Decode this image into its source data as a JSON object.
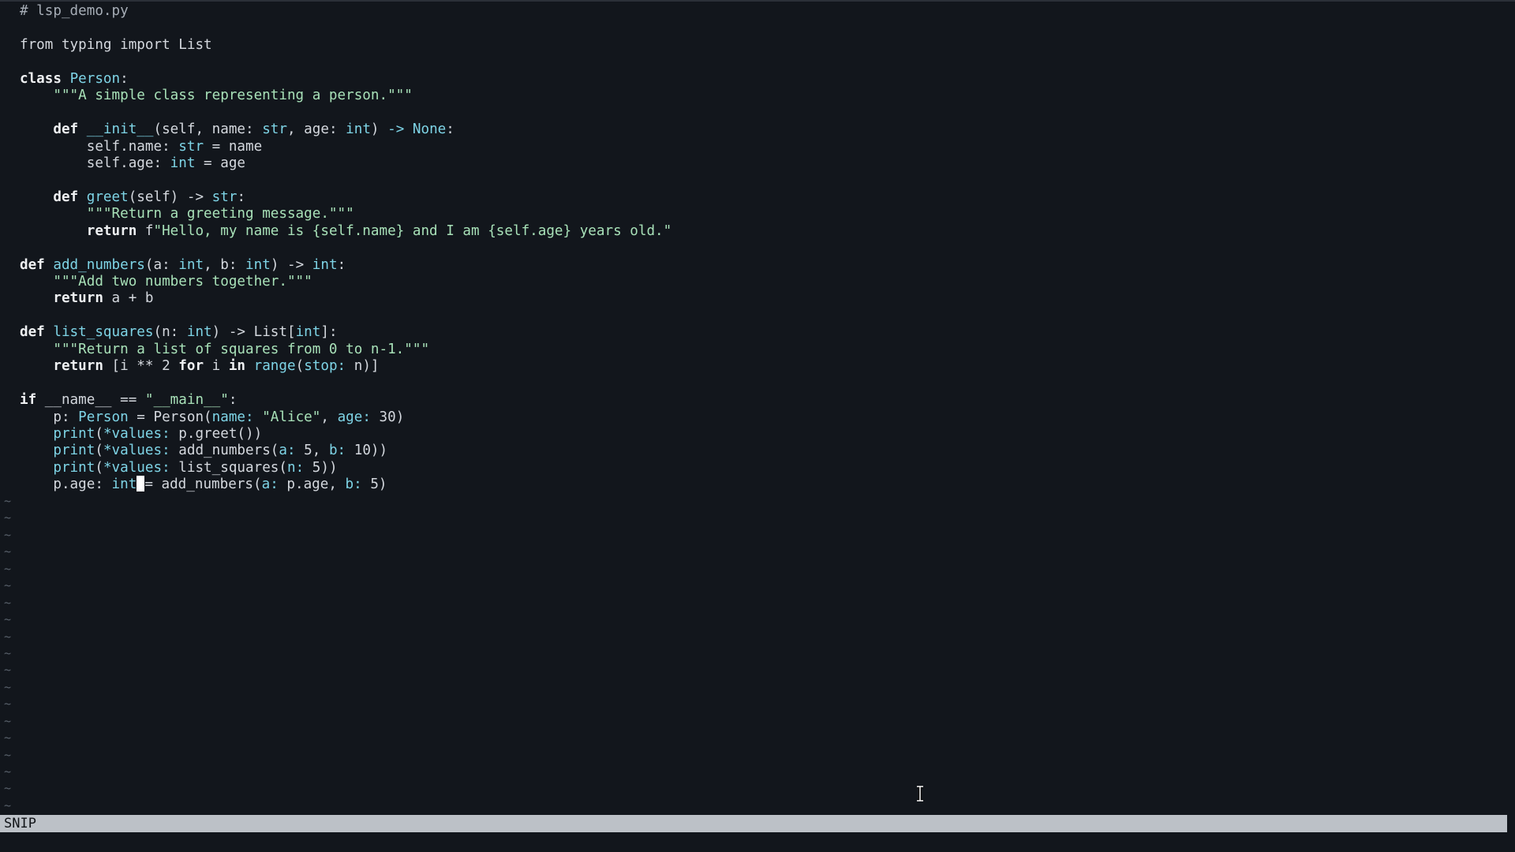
{
  "editor": {
    "file_comment": "# lsp_demo.py",
    "cursor": {
      "line": 29,
      "column": 15
    },
    "lines": [
      [
        {
          "t": "# lsp_demo.py",
          "c": "cm"
        }
      ],
      [],
      [
        {
          "t": "from",
          "c": "df"
        },
        {
          "t": " typing ",
          "c": "df"
        },
        {
          "t": "import",
          "c": "df"
        },
        {
          "t": " List",
          "c": "df"
        }
      ],
      [],
      [
        {
          "t": "class",
          "c": "kw"
        },
        {
          "t": " ",
          "c": "df"
        },
        {
          "t": "Person",
          "c": "fn"
        },
        {
          "t": ":",
          "c": "df"
        }
      ],
      [
        {
          "t": "    ",
          "c": "df"
        },
        {
          "t": "\"\"\"A simple class representing a person.\"\"\"",
          "c": "st"
        }
      ],
      [],
      [
        {
          "t": "    ",
          "c": "df"
        },
        {
          "t": "def",
          "c": "kw"
        },
        {
          "t": " ",
          "c": "df"
        },
        {
          "t": "__init__",
          "c": "fn"
        },
        {
          "t": "(self, name: ",
          "c": "df"
        },
        {
          "t": "str",
          "c": "ty"
        },
        {
          "t": ", age: ",
          "c": "df"
        },
        {
          "t": "int",
          "c": "ty"
        },
        {
          "t": ") ",
          "c": "df"
        },
        {
          "t": "->",
          "c": "ty"
        },
        {
          "t": " ",
          "c": "df"
        },
        {
          "t": "None",
          "c": "ty"
        },
        {
          "t": ":",
          "c": "df"
        }
      ],
      [
        {
          "t": "        self.name: ",
          "c": "df"
        },
        {
          "t": "str",
          "c": "ty"
        },
        {
          "t": " = name",
          "c": "df"
        }
      ],
      [
        {
          "t": "        self.age: ",
          "c": "df"
        },
        {
          "t": "int",
          "c": "ty"
        },
        {
          "t": " = age",
          "c": "df"
        }
      ],
      [],
      [
        {
          "t": "    ",
          "c": "df"
        },
        {
          "t": "def",
          "c": "kw"
        },
        {
          "t": " ",
          "c": "df"
        },
        {
          "t": "greet",
          "c": "fn"
        },
        {
          "t": "(self) -> ",
          "c": "df"
        },
        {
          "t": "str",
          "c": "ty"
        },
        {
          "t": ":",
          "c": "df"
        }
      ],
      [
        {
          "t": "        ",
          "c": "df"
        },
        {
          "t": "\"\"\"Return a greeting message.\"\"\"",
          "c": "st"
        }
      ],
      [
        {
          "t": "        ",
          "c": "df"
        },
        {
          "t": "return",
          "c": "kw"
        },
        {
          "t": " f",
          "c": "df"
        },
        {
          "t": "\"Hello, my name is {self.name} and I am {self.age} years old.\"",
          "c": "st"
        }
      ],
      [],
      [
        {
          "t": "def",
          "c": "kw"
        },
        {
          "t": " ",
          "c": "df"
        },
        {
          "t": "add_numbers",
          "c": "fn"
        },
        {
          "t": "(a: ",
          "c": "df"
        },
        {
          "t": "int",
          "c": "ty"
        },
        {
          "t": ", b: ",
          "c": "df"
        },
        {
          "t": "int",
          "c": "ty"
        },
        {
          "t": ") -> ",
          "c": "df"
        },
        {
          "t": "int",
          "c": "ty"
        },
        {
          "t": ":",
          "c": "df"
        }
      ],
      [
        {
          "t": "    ",
          "c": "df"
        },
        {
          "t": "\"\"\"Add two numbers together.\"\"\"",
          "c": "st"
        }
      ],
      [
        {
          "t": "    ",
          "c": "df"
        },
        {
          "t": "return",
          "c": "kw"
        },
        {
          "t": " a + b",
          "c": "df"
        }
      ],
      [],
      [
        {
          "t": "def",
          "c": "kw"
        },
        {
          "t": " ",
          "c": "df"
        },
        {
          "t": "list_squares",
          "c": "fn"
        },
        {
          "t": "(n: ",
          "c": "df"
        },
        {
          "t": "int",
          "c": "ty"
        },
        {
          "t": ") -> List[",
          "c": "df"
        },
        {
          "t": "int",
          "c": "ty"
        },
        {
          "t": "]:",
          "c": "df"
        }
      ],
      [
        {
          "t": "    ",
          "c": "df"
        },
        {
          "t": "\"\"\"Return a list of squares from 0 to n-1.\"\"\"",
          "c": "st"
        }
      ],
      [
        {
          "t": "    ",
          "c": "df"
        },
        {
          "t": "return",
          "c": "kw"
        },
        {
          "t": " [i ** 2 ",
          "c": "df"
        },
        {
          "t": "for",
          "c": "kw"
        },
        {
          "t": " i ",
          "c": "df"
        },
        {
          "t": "in",
          "c": "kw"
        },
        {
          "t": " ",
          "c": "df"
        },
        {
          "t": "range",
          "c": "fn"
        },
        {
          "t": "(",
          "c": "df"
        },
        {
          "t": "stop:",
          "c": "pm"
        },
        {
          "t": " n)]",
          "c": "df"
        }
      ],
      [],
      [
        {
          "t": "if",
          "c": "kw"
        },
        {
          "t": " __name__ == ",
          "c": "df"
        },
        {
          "t": "\"__main__\"",
          "c": "st"
        },
        {
          "t": ":",
          "c": "df"
        }
      ],
      [
        {
          "t": "    p: ",
          "c": "df"
        },
        {
          "t": "Person",
          "c": "fn"
        },
        {
          "t": " = Person(",
          "c": "df"
        },
        {
          "t": "name:",
          "c": "pm"
        },
        {
          "t": " ",
          "c": "df"
        },
        {
          "t": "\"Alice\"",
          "c": "st"
        },
        {
          "t": ", ",
          "c": "df"
        },
        {
          "t": "age:",
          "c": "pm"
        },
        {
          "t": " 30)",
          "c": "df"
        }
      ],
      [
        {
          "t": "    ",
          "c": "df"
        },
        {
          "t": "print",
          "c": "fn"
        },
        {
          "t": "(",
          "c": "df"
        },
        {
          "t": "*values:",
          "c": "pm"
        },
        {
          "t": " p.greet())",
          "c": "df"
        }
      ],
      [
        {
          "t": "    ",
          "c": "df"
        },
        {
          "t": "print",
          "c": "fn"
        },
        {
          "t": "(",
          "c": "df"
        },
        {
          "t": "*values:",
          "c": "pm"
        },
        {
          "t": " add_numbers(",
          "c": "df"
        },
        {
          "t": "a:",
          "c": "pm"
        },
        {
          "t": " 5, ",
          "c": "df"
        },
        {
          "t": "b:",
          "c": "pm"
        },
        {
          "t": " 10))",
          "c": "df"
        }
      ],
      [
        {
          "t": "    ",
          "c": "df"
        },
        {
          "t": "print",
          "c": "fn"
        },
        {
          "t": "(",
          "c": "df"
        },
        {
          "t": "*values:",
          "c": "pm"
        },
        {
          "t": " list_squares(",
          "c": "df"
        },
        {
          "t": "n:",
          "c": "pm"
        },
        {
          "t": " 5))",
          "c": "df"
        }
      ],
      [
        {
          "t": "    p.age: ",
          "c": "df"
        },
        {
          "t": "int",
          "c": "ty"
        },
        {
          "t": "CURSOR",
          "c": "cursor"
        },
        {
          "t": "= add_numbers(",
          "c": "df"
        },
        {
          "t": "a:",
          "c": "pm"
        },
        {
          "t": " p.age, ",
          "c": "df"
        },
        {
          "t": "b:",
          "c": "pm"
        },
        {
          "t": " 5)",
          "c": "df"
        }
      ]
    ],
    "empty_line_marker": "~",
    "empty_line_count": 19
  },
  "status_bar": {
    "mode": "SNIP"
  },
  "colors": {
    "background": "#12161c",
    "foreground": "#d4d8de",
    "keyword": "#eef0f2",
    "function": "#7ed4e6",
    "string": "#a8e1b8",
    "comment": "#a6adb6",
    "tilde": "#58606a",
    "status_bar_bg": "#bcc1c7",
    "cursor": "#ffffff"
  },
  "icons": {
    "mouse_cursor": "text-ibeam-cursor-icon"
  }
}
